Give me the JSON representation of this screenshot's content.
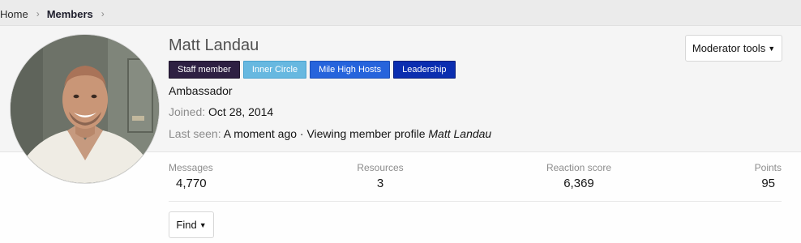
{
  "breadcrumb": {
    "home": "Home",
    "members": "Members",
    "separator": "›"
  },
  "profile": {
    "name": "Matt Landau",
    "banners": {
      "staff": "Staff member",
      "inner": "Inner Circle",
      "mile": "Mile High Hosts",
      "leadership": "Leadership"
    },
    "user_title": "Ambassador",
    "joined_label": "Joined:",
    "joined_value": "Oct 28, 2014",
    "last_seen_label": "Last seen:",
    "last_seen_value": "A moment ago · Viewing member profile",
    "last_seen_target": "Matt Landau"
  },
  "actions": {
    "moderator_tools": "Moderator tools",
    "find": "Find"
  },
  "stats": {
    "messages_label": "Messages",
    "messages_value": "4,770",
    "resources_label": "Resources",
    "resources_value": "3",
    "reaction_label": "Reaction score",
    "reaction_value": "6,369",
    "points_label": "Points",
    "points_value": "95"
  },
  "icons": {
    "caret": "caret-down-icon",
    "chevron": "chevron-right-icon"
  },
  "colors": {
    "staff_banner": "#2e2042",
    "inner_circle_banner": "#67b8e0",
    "mile_high_banner": "#2664dc",
    "leadership_banner": "#0b2eb0"
  }
}
